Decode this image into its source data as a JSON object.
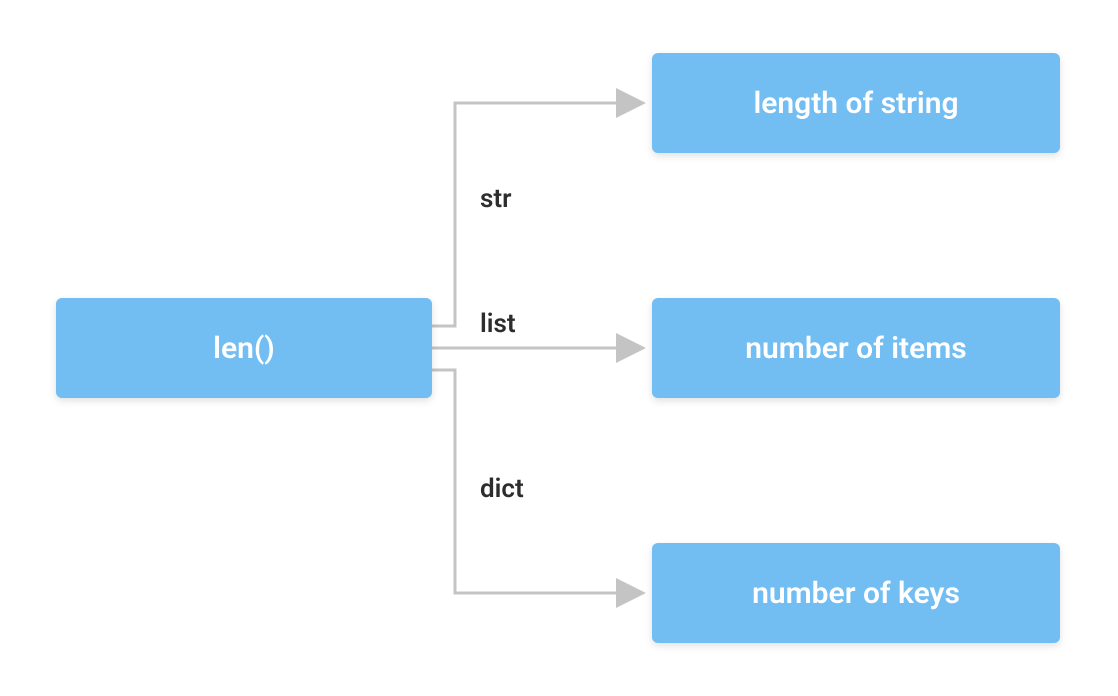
{
  "source": {
    "label": "len()"
  },
  "targets": [
    {
      "label": "length of string"
    },
    {
      "label": "number of items"
    },
    {
      "label": "number of keys"
    }
  ],
  "edges": [
    {
      "label": "str"
    },
    {
      "label": "list"
    },
    {
      "label": "dict"
    }
  ],
  "colors": {
    "node_bg": "#72bdf2",
    "node_text": "#ffffff",
    "arrow": "#c4c4c4",
    "label": "#2d2d2d"
  }
}
